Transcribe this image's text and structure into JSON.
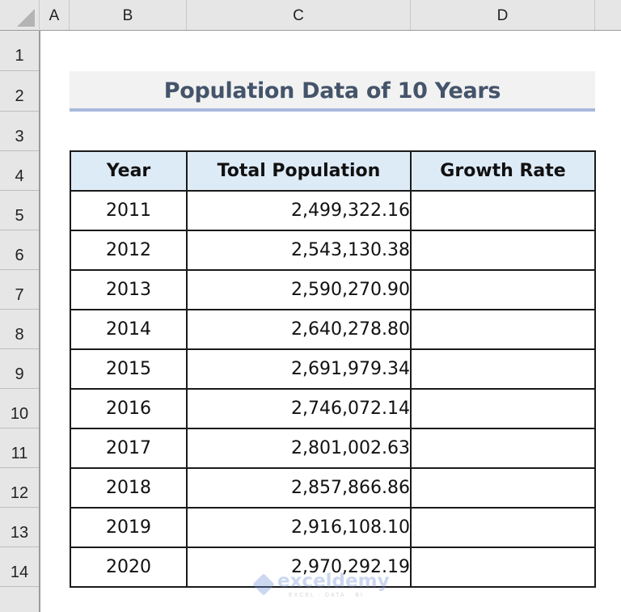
{
  "spreadsheet": {
    "columns": [
      "A",
      "B",
      "C",
      "D"
    ],
    "rows": [
      "1",
      "2",
      "3",
      "4",
      "5",
      "6",
      "7",
      "8",
      "9",
      "10",
      "11",
      "12",
      "13",
      "14"
    ]
  },
  "title": "Population Data of 10 Years",
  "table": {
    "headers": [
      "Year",
      "Total Population",
      "Growth Rate"
    ],
    "rows": [
      {
        "year": "2011",
        "population": "2,499,322.16",
        "growth": ""
      },
      {
        "year": "2012",
        "population": "2,543,130.38",
        "growth": ""
      },
      {
        "year": "2013",
        "population": "2,590,270.90",
        "growth": ""
      },
      {
        "year": "2014",
        "population": "2,640,278.80",
        "growth": ""
      },
      {
        "year": "2015",
        "population": "2,691,979.34",
        "growth": ""
      },
      {
        "year": "2016",
        "population": "2,746,072.14",
        "growth": ""
      },
      {
        "year": "2017",
        "population": "2,801,002.63",
        "growth": ""
      },
      {
        "year": "2018",
        "population": "2,857,866.86",
        "growth": ""
      },
      {
        "year": "2019",
        "population": "2,916,108.10",
        "growth": ""
      },
      {
        "year": "2020",
        "population": "2,970,292.19",
        "growth": ""
      }
    ]
  },
  "watermark": {
    "name": "exceldemy",
    "tagline": "EXCEL · DATA · BI"
  },
  "colors": {
    "title_text": "#44546a",
    "title_bg": "#f2f2f2",
    "title_border": "#a9b9dc",
    "header_bg": "#ddebf7"
  }
}
